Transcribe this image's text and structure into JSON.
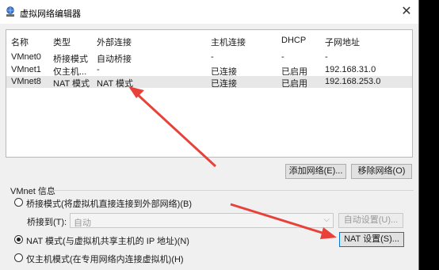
{
  "window": {
    "title": "虚拟网络编辑器",
    "close_glyph": "✕",
    "icon": "network-globe-icon"
  },
  "table": {
    "headers": [
      "名称",
      "类型",
      "外部连接",
      "主机连接",
      "DHCP",
      "子网地址"
    ],
    "rows": [
      [
        "VMnet0",
        "桥接模式",
        "自动桥接",
        "-",
        "-",
        "-"
      ],
      [
        "VMnet1",
        "仅主机...",
        "-",
        "已连接",
        "已启用",
        "192.168.31.0"
      ],
      [
        "VMnet8",
        "NAT 模式",
        "NAT 模式",
        "已连接",
        "已启用",
        "192.168.253.0"
      ]
    ],
    "selected_row": 2
  },
  "buttons": {
    "add_network": "添加网络(E)...",
    "remove_network": "移除网络(O)",
    "auto_settings": "自动设置(U)...",
    "nat_settings": "NAT 设置(S)..."
  },
  "vmnet_info": {
    "group_label": "VMnet 信息",
    "bridged_mode": "桥接模式(将虚拟机直接连接到外部网络)(B)",
    "bridged_to_label": "桥接到(T):",
    "bridged_to_value": "自动",
    "nat_mode": "NAT 模式(与虚拟机共享主机的 IP 地址)(N)",
    "host_only_mode": "仅主机模式(在专用网络内连接虚拟机)(H)",
    "selected_mode": "nat"
  },
  "colors": {
    "annotation_arrow": "#e8413a",
    "selection_bg": "#e7e7e7",
    "focus_border": "#0078d7"
  }
}
